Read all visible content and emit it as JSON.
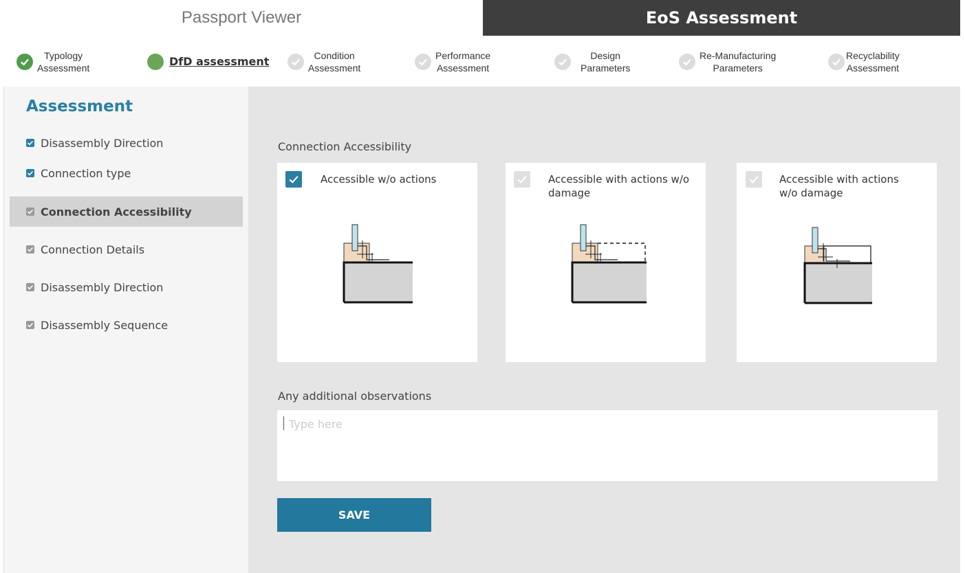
{
  "tabs": {
    "left": "Passport Viewer",
    "right": "EoS Assessment"
  },
  "steps": [
    {
      "line1": "Typology",
      "line2": "Assessment",
      "state": "done"
    },
    {
      "line1": "DfD assessment",
      "line2": "",
      "state": "current"
    },
    {
      "line1": "Condition",
      "line2": "Assessment",
      "state": "todo"
    },
    {
      "line1": "Performance",
      "line2": "Assessment",
      "state": "todo"
    },
    {
      "line1": "Design",
      "line2": "Parameters",
      "state": "todo"
    },
    {
      "line1": "Re-Manufacturing",
      "line2": "Parameters",
      "state": "todo"
    },
    {
      "line1": "Recyclability",
      "line2": "Assessment",
      "state": "todo"
    }
  ],
  "sidebar": {
    "title": "Assessment",
    "items": [
      {
        "label": "Disassembly Direction",
        "checked": true
      },
      {
        "label": "Connection type",
        "checked": true
      },
      {
        "label": "Connection Accessibility",
        "checked": true,
        "active": true
      },
      {
        "label": "Connection Details",
        "checked": false
      },
      {
        "label": "Disassembly Direction",
        "checked": false
      },
      {
        "label": "Disassembly Sequence",
        "checked": false
      }
    ]
  },
  "main": {
    "section_label": "Connection Accessibility",
    "options": [
      {
        "label_line1": "Accessible w/o actions",
        "label_line2": "",
        "selected": true
      },
      {
        "label_line1": "Accessible with actions w/o",
        "label_line2": "damage",
        "selected": false
      },
      {
        "label_line1": "Accessible with actions",
        "label_line2": "w/o damage",
        "selected": false
      }
    ],
    "observations_label": "Any additional observations",
    "observations_placeholder": "Type here",
    "observations_value": "",
    "save_label": "SAVE"
  },
  "colors": {
    "accent": "#2a7fa3",
    "done_green": "#4f9d4c",
    "dark_tab": "#3e3e3e",
    "wood": "#f0d9bf",
    "glass": "#bfe3ec",
    "concrete": "#d4d4d4"
  }
}
